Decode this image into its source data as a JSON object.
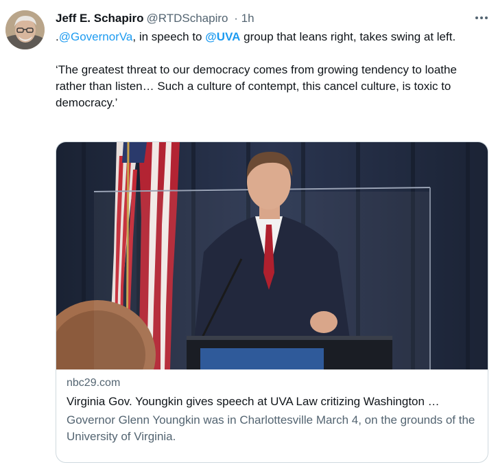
{
  "author": {
    "name": "Jeff E. Schapiro",
    "handle": "@RTDSchapiro",
    "separator": "·",
    "time": "1h"
  },
  "more_icon": "ellipsis-horizontal-icon",
  "tweet": {
    "p1_prefix": ".",
    "p1_mention1": "@GovernorVa",
    "p1_mid": ", in speech to ",
    "p1_mention2": "@UVA",
    "p1_suffix": " group that leans right, takes swing at left.",
    "p2": "‘The greatest threat to our democracy comes from growing tendency to loathe rather than listen… Such a culture of contempt, this cancel culture, is toxic to democracy.’"
  },
  "card": {
    "domain": "nbc29.com",
    "title": "Virginia Gov. Youngkin gives speech at UVA Law critizing Washington …",
    "description": "Governor Glenn Youngkin was in Charlottesville March 4, on the grounds of the University of Virginia."
  },
  "colors": {
    "link": "#1d9bf0",
    "secondary_text": "#536471",
    "border": "#cfd9de"
  }
}
